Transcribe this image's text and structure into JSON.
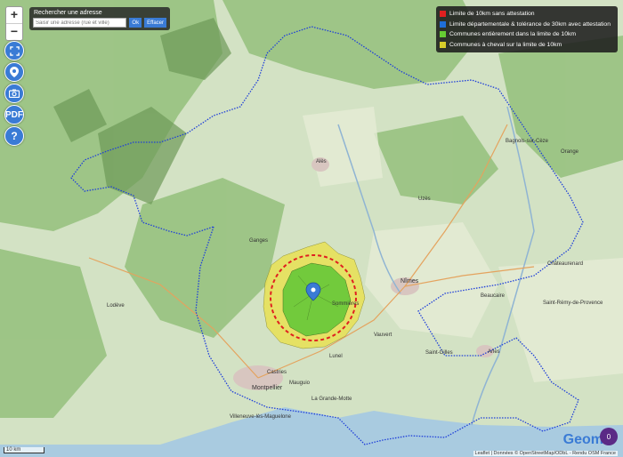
{
  "search": {
    "title": "Rechercher une adresse",
    "placeholder": "Saisir une adresse (rue et ville)",
    "ok_label": "Ok",
    "clear_label": "Effacer"
  },
  "zoom": {
    "in_label": "+",
    "out_label": "−"
  },
  "tools": {
    "fullscreen_icon": "fullscreen-icon",
    "locate_icon": "map-marker-icon",
    "camera_icon": "camera-icon",
    "pdf_label": "PDF",
    "help_label": "?"
  },
  "legend": {
    "items": [
      {
        "label": "Limite de 10km sans attestation",
        "color": "#e02020"
      },
      {
        "label": "Limite départementale & tolérance de 30km avec attestation",
        "color": "#1f6fd9"
      },
      {
        "label": "Communes entièrement dans la limite de 10km",
        "color": "#66cc33"
      },
      {
        "label": "Communes à cheval sur la limite de 10km",
        "color": "#d6cc2a"
      }
    ]
  },
  "places": [
    "Montpellier",
    "Nîmes",
    "Alès",
    "Lunel",
    "Sommières",
    "Arles",
    "Beaucaire",
    "Bagnols-sur-Cèze",
    "Orange",
    "Ganges",
    "Lodève",
    "Castries",
    "Mauguio",
    "La Grande-Motte",
    "Uzès",
    "Vauvert",
    "Saint-Gilles",
    "Châteaurenard",
    "Saint-Rémy-de-Provence",
    "Villeneuve-lès-Maguelone"
  ],
  "scale_label": "10 km",
  "attribution": "Leaflet | Données © OpenStreetMap/ODbL - Rendu OSM France",
  "logo_text": "Geom",
  "badge_count": "0",
  "colors": {
    "water": "#a9cbe0",
    "forest": "#8fbf78",
    "land": "#dbe6cc",
    "urban": "#d9c9c5"
  }
}
